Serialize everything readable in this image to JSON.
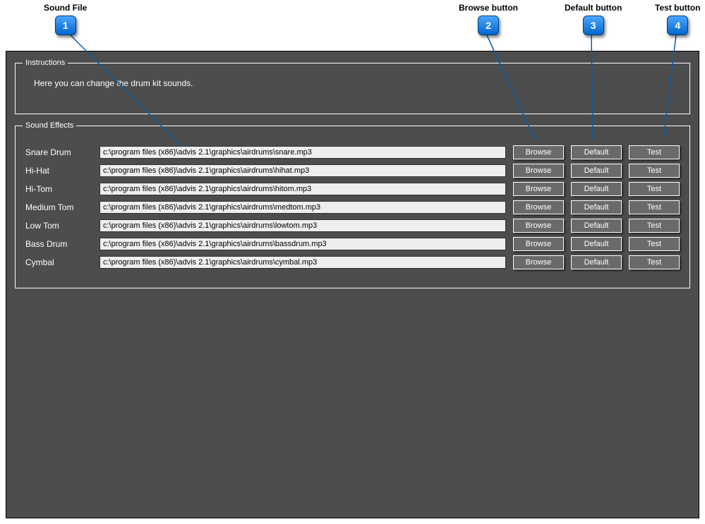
{
  "callouts": [
    {
      "label": "Sound File",
      "num": "1"
    },
    {
      "label": "Browse button",
      "num": "2"
    },
    {
      "label": "Default button",
      "num": "3"
    },
    {
      "label": "Test button",
      "num": "4"
    }
  ],
  "instructions": {
    "legend": "Instructions",
    "text": "Here you can change the drum kit sounds."
  },
  "soundEffects": {
    "legend": "Sound Effects",
    "browseLabel": "Browse",
    "defaultLabel": "Default",
    "testLabel": "Test",
    "rows": [
      {
        "name": "Snare Drum",
        "path": "c:\\program files (x86)\\advis 2.1\\graphics\\airdrums\\snare.mp3"
      },
      {
        "name": "Hi-Hat",
        "path": "c:\\program files (x86)\\advis 2.1\\graphics\\airdrums\\hihat.mp3"
      },
      {
        "name": "Hi-Tom",
        "path": "c:\\program files (x86)\\advis 2.1\\graphics\\airdrums\\hitom.mp3"
      },
      {
        "name": "Medium Tom",
        "path": "c:\\program files (x86)\\advis 2.1\\graphics\\airdrums\\medtom.mp3"
      },
      {
        "name": "Low Tom",
        "path": "c:\\program files (x86)\\advis 2.1\\graphics\\airdrums\\lowtom.mp3"
      },
      {
        "name": "Bass Drum",
        "path": "c:\\program files (x86)\\advis 2.1\\graphics\\airdrums\\bassdrum.mp3"
      },
      {
        "name": "Cymbal",
        "path": "c:\\program files (x86)\\advis 2.1\\graphics\\airdrums\\cymbal.mp3"
      }
    ]
  }
}
